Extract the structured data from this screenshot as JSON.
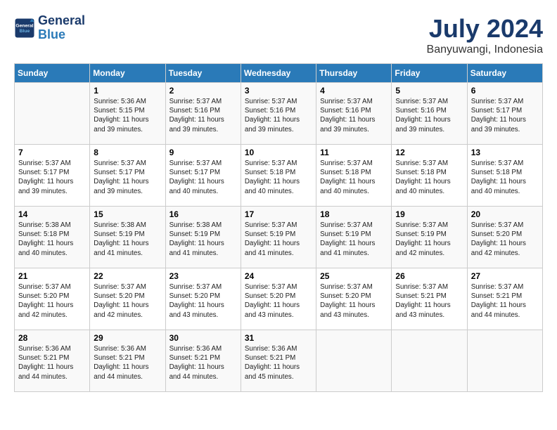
{
  "logo": {
    "line1": "General",
    "line2": "Blue"
  },
  "title": "July 2024",
  "location": "Banyuwangi, Indonesia",
  "columns": [
    "Sunday",
    "Monday",
    "Tuesday",
    "Wednesday",
    "Thursday",
    "Friday",
    "Saturday"
  ],
  "weeks": [
    [
      {
        "day": "",
        "info": ""
      },
      {
        "day": "1",
        "info": "Sunrise: 5:36 AM\nSunset: 5:15 PM\nDaylight: 11 hours\nand 39 minutes."
      },
      {
        "day": "2",
        "info": "Sunrise: 5:37 AM\nSunset: 5:16 PM\nDaylight: 11 hours\nand 39 minutes."
      },
      {
        "day": "3",
        "info": "Sunrise: 5:37 AM\nSunset: 5:16 PM\nDaylight: 11 hours\nand 39 minutes."
      },
      {
        "day": "4",
        "info": "Sunrise: 5:37 AM\nSunset: 5:16 PM\nDaylight: 11 hours\nand 39 minutes."
      },
      {
        "day": "5",
        "info": "Sunrise: 5:37 AM\nSunset: 5:16 PM\nDaylight: 11 hours\nand 39 minutes."
      },
      {
        "day": "6",
        "info": "Sunrise: 5:37 AM\nSunset: 5:17 PM\nDaylight: 11 hours\nand 39 minutes."
      }
    ],
    [
      {
        "day": "7",
        "info": "Sunrise: 5:37 AM\nSunset: 5:17 PM\nDaylight: 11 hours\nand 39 minutes."
      },
      {
        "day": "8",
        "info": "Sunrise: 5:37 AM\nSunset: 5:17 PM\nDaylight: 11 hours\nand 39 minutes."
      },
      {
        "day": "9",
        "info": "Sunrise: 5:37 AM\nSunset: 5:17 PM\nDaylight: 11 hours\nand 40 minutes."
      },
      {
        "day": "10",
        "info": "Sunrise: 5:37 AM\nSunset: 5:18 PM\nDaylight: 11 hours\nand 40 minutes."
      },
      {
        "day": "11",
        "info": "Sunrise: 5:37 AM\nSunset: 5:18 PM\nDaylight: 11 hours\nand 40 minutes."
      },
      {
        "day": "12",
        "info": "Sunrise: 5:37 AM\nSunset: 5:18 PM\nDaylight: 11 hours\nand 40 minutes."
      },
      {
        "day": "13",
        "info": "Sunrise: 5:37 AM\nSunset: 5:18 PM\nDaylight: 11 hours\nand 40 minutes."
      }
    ],
    [
      {
        "day": "14",
        "info": "Sunrise: 5:38 AM\nSunset: 5:18 PM\nDaylight: 11 hours\nand 40 minutes."
      },
      {
        "day": "15",
        "info": "Sunrise: 5:38 AM\nSunset: 5:19 PM\nDaylight: 11 hours\nand 41 minutes."
      },
      {
        "day": "16",
        "info": "Sunrise: 5:38 AM\nSunset: 5:19 PM\nDaylight: 11 hours\nand 41 minutes."
      },
      {
        "day": "17",
        "info": "Sunrise: 5:37 AM\nSunset: 5:19 PM\nDaylight: 11 hours\nand 41 minutes."
      },
      {
        "day": "18",
        "info": "Sunrise: 5:37 AM\nSunset: 5:19 PM\nDaylight: 11 hours\nand 41 minutes."
      },
      {
        "day": "19",
        "info": "Sunrise: 5:37 AM\nSunset: 5:19 PM\nDaylight: 11 hours\nand 42 minutes."
      },
      {
        "day": "20",
        "info": "Sunrise: 5:37 AM\nSunset: 5:20 PM\nDaylight: 11 hours\nand 42 minutes."
      }
    ],
    [
      {
        "day": "21",
        "info": "Sunrise: 5:37 AM\nSunset: 5:20 PM\nDaylight: 11 hours\nand 42 minutes."
      },
      {
        "day": "22",
        "info": "Sunrise: 5:37 AM\nSunset: 5:20 PM\nDaylight: 11 hours\nand 42 minutes."
      },
      {
        "day": "23",
        "info": "Sunrise: 5:37 AM\nSunset: 5:20 PM\nDaylight: 11 hours\nand 43 minutes."
      },
      {
        "day": "24",
        "info": "Sunrise: 5:37 AM\nSunset: 5:20 PM\nDaylight: 11 hours\nand 43 minutes."
      },
      {
        "day": "25",
        "info": "Sunrise: 5:37 AM\nSunset: 5:20 PM\nDaylight: 11 hours\nand 43 minutes."
      },
      {
        "day": "26",
        "info": "Sunrise: 5:37 AM\nSunset: 5:21 PM\nDaylight: 11 hours\nand 43 minutes."
      },
      {
        "day": "27",
        "info": "Sunrise: 5:37 AM\nSunset: 5:21 PM\nDaylight: 11 hours\nand 44 minutes."
      }
    ],
    [
      {
        "day": "28",
        "info": "Sunrise: 5:36 AM\nSunset: 5:21 PM\nDaylight: 11 hours\nand 44 minutes."
      },
      {
        "day": "29",
        "info": "Sunrise: 5:36 AM\nSunset: 5:21 PM\nDaylight: 11 hours\nand 44 minutes."
      },
      {
        "day": "30",
        "info": "Sunrise: 5:36 AM\nSunset: 5:21 PM\nDaylight: 11 hours\nand 44 minutes."
      },
      {
        "day": "31",
        "info": "Sunrise: 5:36 AM\nSunset: 5:21 PM\nDaylight: 11 hours\nand 45 minutes."
      },
      {
        "day": "",
        "info": ""
      },
      {
        "day": "",
        "info": ""
      },
      {
        "day": "",
        "info": ""
      }
    ]
  ]
}
